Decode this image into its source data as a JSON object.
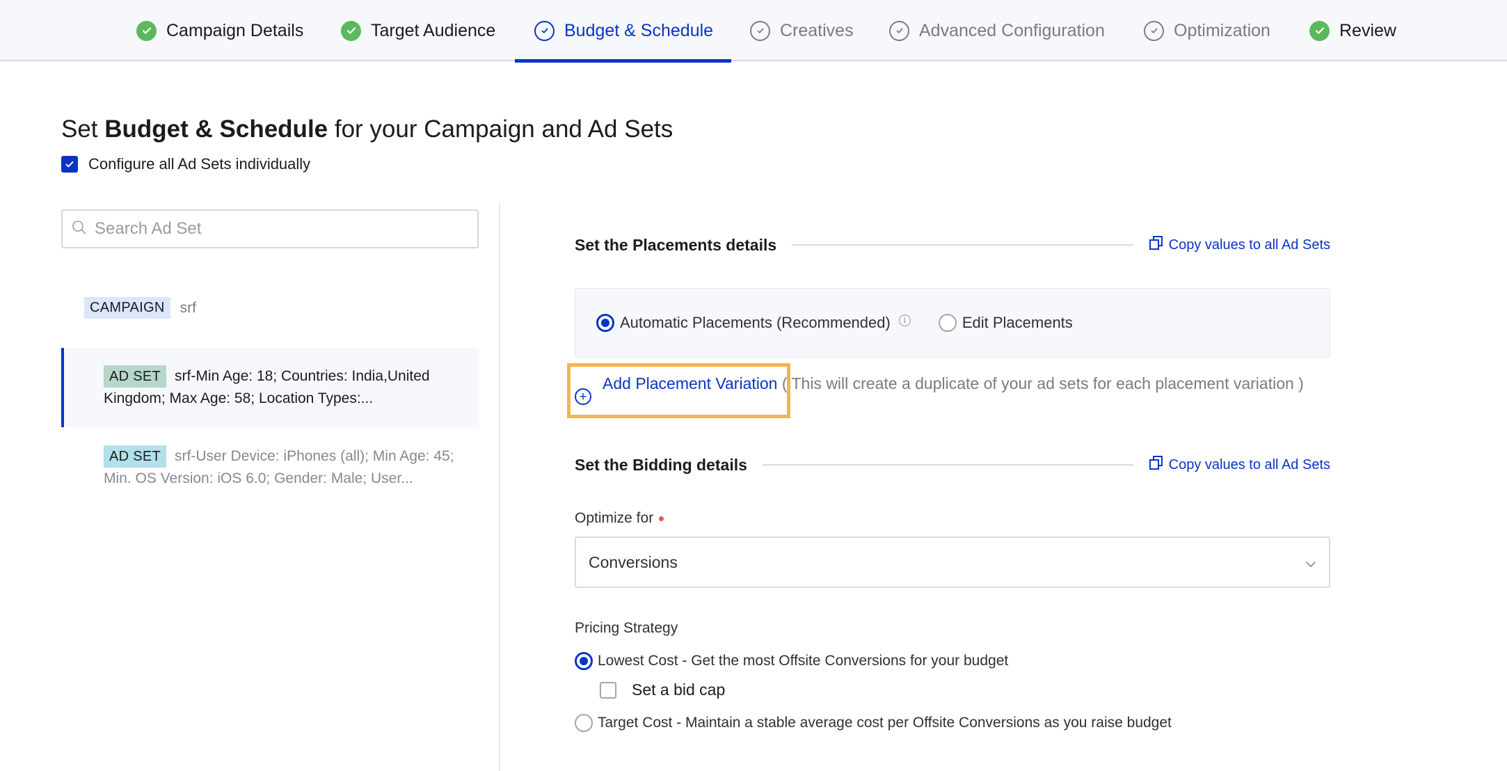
{
  "stepper": {
    "steps": [
      {
        "label": "Campaign Details",
        "state": "done"
      },
      {
        "label": "Target Audience",
        "state": "done"
      },
      {
        "label": "Budget & Schedule",
        "state": "active"
      },
      {
        "label": "Creatives",
        "state": "pending"
      },
      {
        "label": "Advanced Configuration",
        "state": "pending"
      },
      {
        "label": "Optimization",
        "state": "pending"
      },
      {
        "label": "Review",
        "state": "done"
      }
    ]
  },
  "header": {
    "title_prefix": "Set ",
    "title_bold": "Budget & Schedule",
    "title_suffix": " for your Campaign and Ad Sets",
    "configure_individually_label": "Configure all Ad Sets individually",
    "configure_individually_checked": true
  },
  "left_panel": {
    "search_placeholder": "Search Ad Set",
    "search_value": "",
    "campaign": {
      "badge": "CAMPAIGN",
      "name": "srf"
    },
    "ad_sets": [
      {
        "badge": "AD SET",
        "name": "srf-Min Age: 18; Countries: India,United Kingdom; Max Age: 58; Location Types:...",
        "selected": true
      },
      {
        "badge": "AD SET",
        "name": "srf-User Device: iPhones (all); Min Age: 45; Min. OS Version: iOS 6.0; Gender: Male; User...",
        "selected": false
      }
    ]
  },
  "placements": {
    "title": "Set the Placements details",
    "copy_label": "Copy values to all Ad Sets",
    "options": [
      {
        "label": "Automatic Placements (Recommended)",
        "selected": true,
        "has_info": true
      },
      {
        "label": "Edit Placements",
        "selected": false
      }
    ],
    "info_glyph": "i",
    "add_variation_label": "Add Placement Variation",
    "add_variation_note": "( This will create a duplicate of your ad sets for each placement variation )",
    "plus_glyph": "+"
  },
  "bidding": {
    "title": "Set the Bidding details",
    "copy_label": "Copy values to all Ad Sets",
    "optimize_label": "Optimize for",
    "optimize_required": true,
    "optimize_value": "Conversions",
    "pricing_label": "Pricing Strategy",
    "pricing_options": [
      {
        "label": "Lowest Cost - Get the most Offsite Conversions for your budget",
        "selected": true
      },
      {
        "label": "Target Cost - Maintain a stable average cost per Offsite Conversions as you raise budget",
        "selected": false
      }
    ],
    "bid_cap_label": "Set a bid cap",
    "bid_cap_checked": false
  },
  "colors": {
    "accent": "#0b34c3",
    "success": "#5cb85c",
    "highlight": "#f4b351",
    "required": "#e55a5a"
  }
}
